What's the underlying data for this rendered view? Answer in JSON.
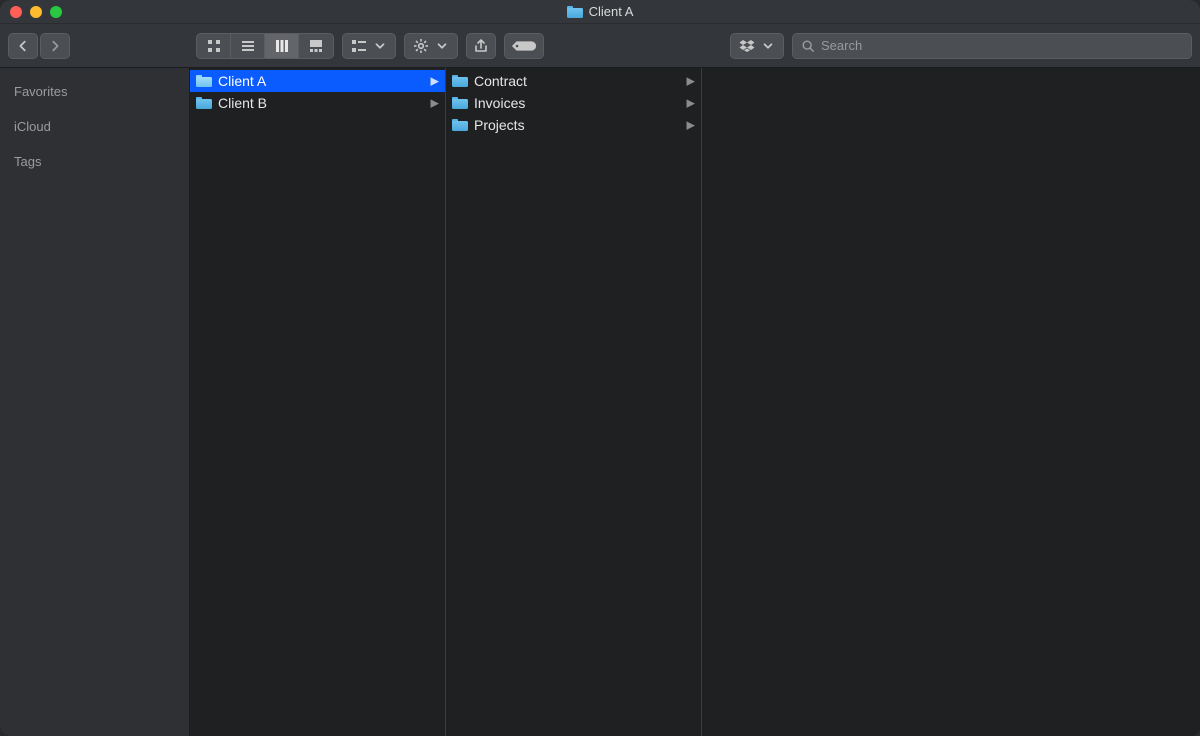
{
  "window": {
    "title": "Client A"
  },
  "toolbar": {
    "search_placeholder": "Search"
  },
  "sidebar": {
    "sections": [
      {
        "label": "Favorites"
      },
      {
        "label": "iCloud"
      },
      {
        "label": "Tags"
      }
    ]
  },
  "columns": [
    {
      "items": [
        {
          "name": "Client A",
          "selected": true,
          "has_children": true
        },
        {
          "name": "Client B",
          "selected": false,
          "has_children": true
        }
      ]
    },
    {
      "items": [
        {
          "name": "Contract",
          "selected": false,
          "has_children": true
        },
        {
          "name": "Invoices",
          "selected": false,
          "has_children": true
        },
        {
          "name": "Projects",
          "selected": false,
          "has_children": true
        }
      ]
    },
    {
      "items": []
    }
  ]
}
